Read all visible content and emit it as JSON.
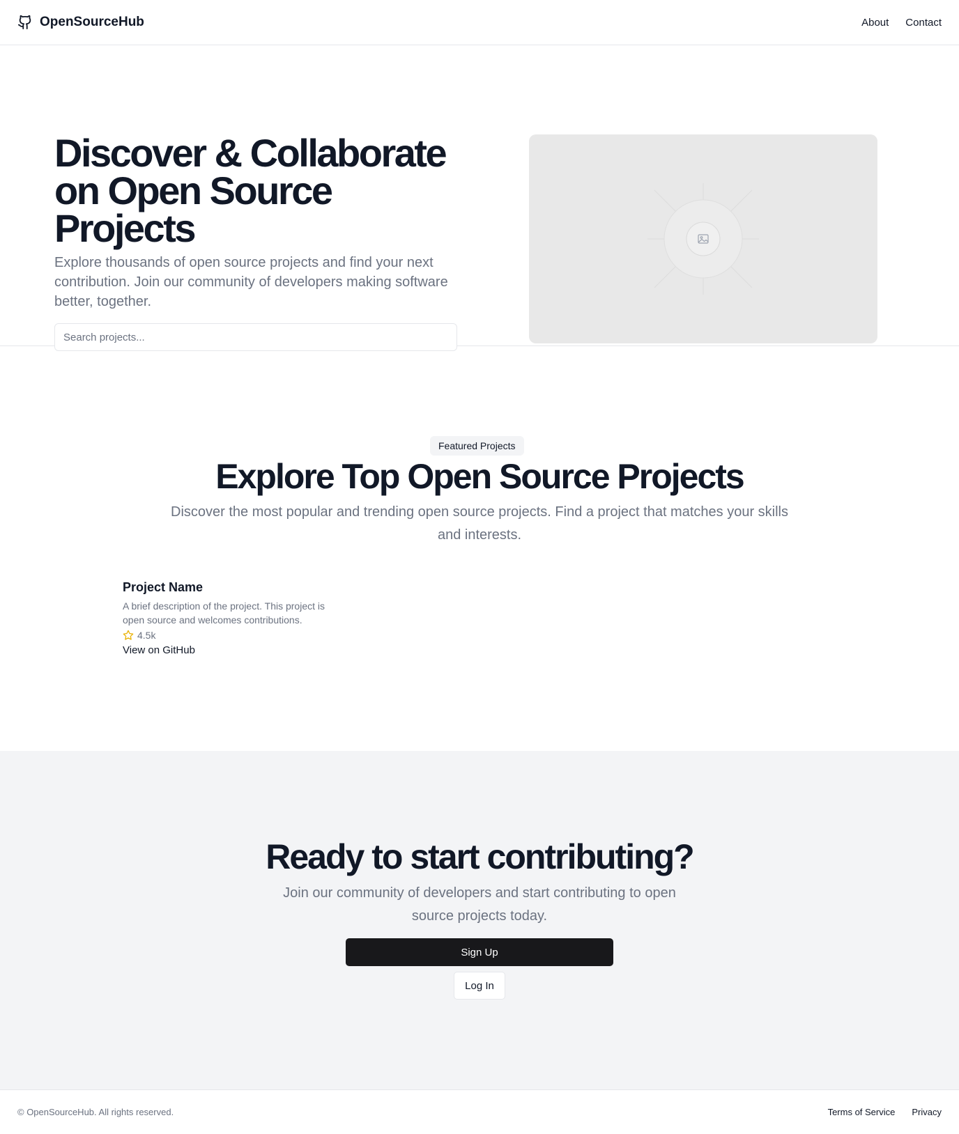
{
  "header": {
    "brand_icon": "github-icon",
    "brand_name": "OpenSourceHub",
    "nav": [
      {
        "label": "About"
      },
      {
        "label": "Contact"
      }
    ]
  },
  "hero": {
    "title": "Discover & Collaborate on Open Source Projects",
    "subtitle": "Explore thousands of open source projects and find your next contribution. Join our community of developers making software better, together.",
    "search_placeholder": "Search projects...",
    "image_icon": "image-placeholder-icon"
  },
  "featured": {
    "badge": "Featured Projects",
    "title": "Explore Top Open Source Projects",
    "subtitle": "Discover the most popular and trending open source projects. Find a project that matches your skills and interests.",
    "projects": [
      {
        "name": "Project Name",
        "description": "A brief description of the project. This project is open source and welcomes contributions.",
        "stars": "4.5k",
        "star_icon": "star-icon",
        "star_color": "#eab308",
        "link_label": "View on GitHub"
      }
    ]
  },
  "cta": {
    "title": "Ready to start contributing?",
    "subtitle": "Join our community of developers and start contributing to open source projects today.",
    "primary_label": "Sign Up",
    "secondary_label": "Log In"
  },
  "footer": {
    "copyright": "© OpenSourceHub. All rights reserved.",
    "links": [
      {
        "label": "Terms of Service"
      },
      {
        "label": "Privacy"
      }
    ]
  },
  "colors": {
    "text_primary": "#111827",
    "text_muted": "#6b7280",
    "primary_button": "#18181b",
    "section_bg": "#f3f4f6"
  }
}
